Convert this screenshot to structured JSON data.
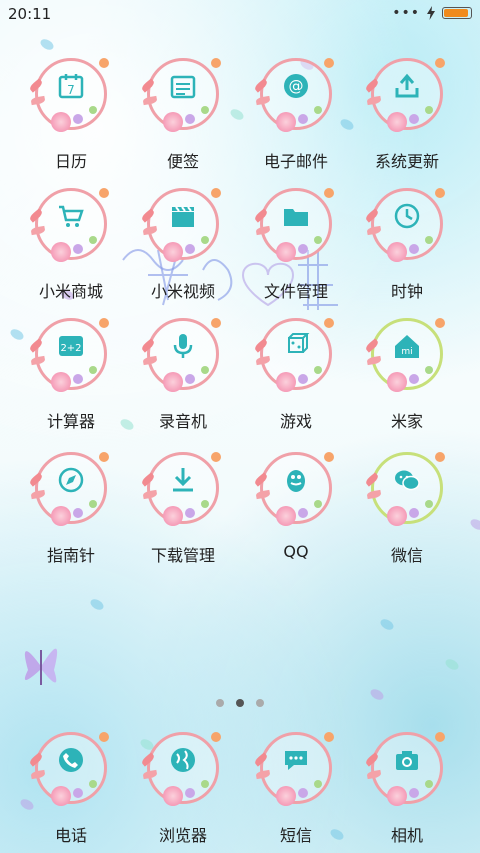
{
  "status_bar": {
    "time": "20:11"
  },
  "apps": [
    {
      "label": "日历",
      "icon": "calendar-icon",
      "glyph": "7"
    },
    {
      "label": "便签",
      "icon": "notes-icon"
    },
    {
      "label": "电子邮件",
      "icon": "email-icon",
      "glyph": "@"
    },
    {
      "label": "系统更新",
      "icon": "update-icon"
    },
    {
      "label": "小米商城",
      "icon": "shop-cart-icon"
    },
    {
      "label": "小米视频",
      "icon": "video-clapper-icon"
    },
    {
      "label": "文件管理",
      "icon": "folder-icon"
    },
    {
      "label": "时钟",
      "icon": "clock-icon"
    },
    {
      "label": "计算器",
      "icon": "calculator-icon",
      "glyph": "2+2"
    },
    {
      "label": "录音机",
      "icon": "microphone-icon"
    },
    {
      "label": "游戏",
      "icon": "game-icon"
    },
    {
      "label": "米家",
      "icon": "mi-home-icon",
      "glyph": "mi"
    },
    {
      "label": "指南针",
      "icon": "compass-icon"
    },
    {
      "label": "下载管理",
      "icon": "download-icon"
    },
    {
      "label": "QQ",
      "icon": "qq-penguin-icon"
    },
    {
      "label": "微信",
      "icon": "wechat-icon"
    }
  ],
  "dock": [
    {
      "label": "电话",
      "icon": "phone-icon"
    },
    {
      "label": "浏览器",
      "icon": "globe-icon"
    },
    {
      "label": "短信",
      "icon": "message-icon"
    },
    {
      "label": "相机",
      "icon": "camera-icon"
    }
  ],
  "page_indicator": {
    "count": 3,
    "active_index": 1
  },
  "colors": {
    "accent": "#2db3b8",
    "ring": "#f0a0a8",
    "battery": "#f08a1c"
  }
}
